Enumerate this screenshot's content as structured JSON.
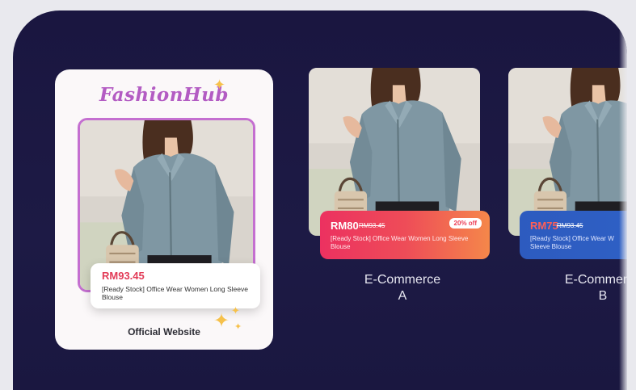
{
  "official": {
    "brand": "FashionHub",
    "price": "RM93.45",
    "product": "[Ready Stock] Office Wear Women Long Sleeve Blouse",
    "label": "Official Website"
  },
  "ecommerce_a": {
    "price": "RM80",
    "old_price": "RM93.45",
    "badge": "20% off",
    "product": "[Ready Stock] Office Wear Women Long Sleeve Blouse",
    "label_line1": "E-Commerce",
    "label_line2": "A"
  },
  "ecommerce_b": {
    "price": "RM75",
    "old_price": "RM93.45",
    "product": "[Ready Stock] Office Wear W Sleeve Blouse",
    "label_line1": "E-Commerce",
    "label_line2": "B"
  },
  "icons": {
    "sparkle": "sparkle-icon"
  },
  "colors": {
    "background": "#1a1640",
    "brand": "#b35cc3",
    "price_red": "#e23b57",
    "promo_gradient_start": "#ec3160",
    "promo_gradient_end": "#f5874a",
    "promo_blue": "#2d5bbf",
    "sparkle": "#f6c14b"
  }
}
